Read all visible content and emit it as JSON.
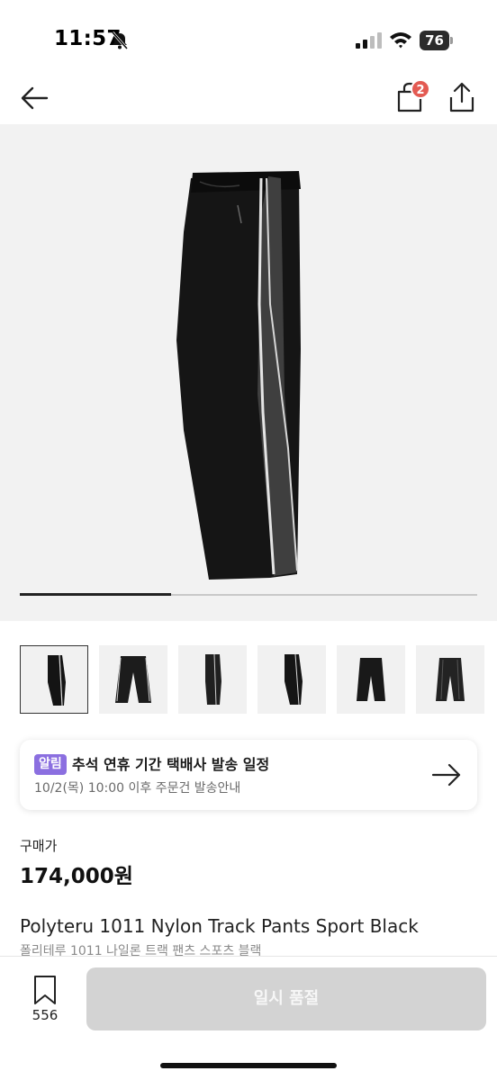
{
  "status_bar": {
    "time": "11:57",
    "battery": "76"
  },
  "nav": {
    "cart_count": "2"
  },
  "gallery": {
    "progress": 0.33,
    "thumbnail_count": 6
  },
  "notice": {
    "badge": "알림",
    "title": "추석 연휴 기간 택배사 발송 일정",
    "subtitle": "10/2(목) 10:00 이후 주문건 발송안내"
  },
  "product": {
    "price_label": "구매가",
    "price": "174,000원",
    "title": "Polyteru 1011 Nylon Track Pants Sport Black",
    "title_ko": "폴리테루 1011 나일론 트랙 팬츠 스포츠 블랙"
  },
  "bottom_bar": {
    "bookmark_count": "556",
    "action_label": "일시 품절"
  },
  "colors": {
    "badge_purple": "#8b6fe0",
    "cart_badge": "#e35a52",
    "button_disabled": "#d3d3d3"
  }
}
